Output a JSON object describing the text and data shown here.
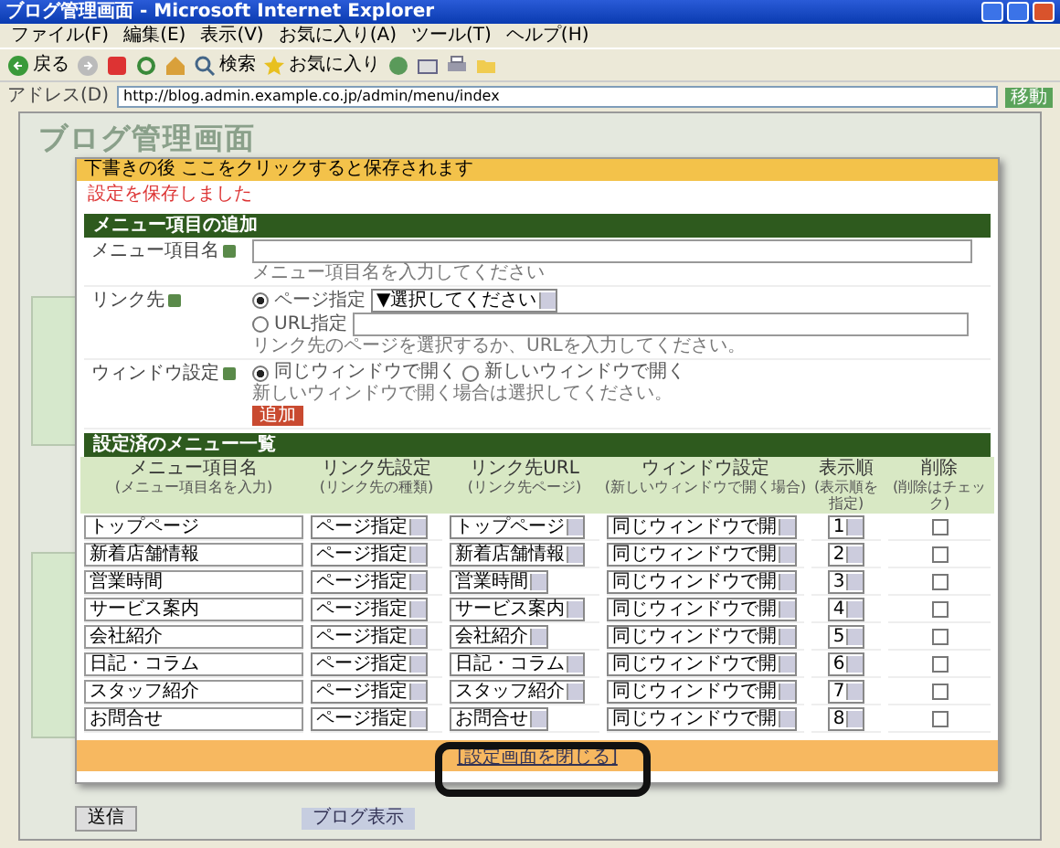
{
  "window": {
    "title": "ブログ管理画面 - Microsoft Internet Explorer"
  },
  "menu_bar": [
    "ファイル(F)",
    "編集(E)",
    "表示(V)",
    "お気に入り(A)",
    "ツール(T)",
    "ヘルプ(H)"
  ],
  "toolbar": {
    "back": "戻る",
    "search": "検索",
    "favorites": "お気に入り"
  },
  "address_bar": {
    "label": "アドレス(D)",
    "value": "http://blog.admin.example.co.jp/admin/menu/index",
    "go": "移動"
  },
  "page": {
    "heading": "ブログ管理画面",
    "send_button": "送信",
    "blog_link": "ブログ表示"
  },
  "dialog": {
    "notice": "下書きの後 ここをクリックすると保存されます",
    "message": "設定を保存しました",
    "add_section": {
      "title": "メニュー項目の追加",
      "name_field": {
        "label": "メニュー項目名",
        "hint": "メニュー項目名を入力してください"
      },
      "link_field": {
        "label": "リンク先",
        "options": [
          {
            "label": "ページ指定",
            "selected": true,
            "kind": "select",
            "value": "▼選択してください"
          },
          {
            "label": "URL指定",
            "selected": false,
            "kind": "input"
          }
        ],
        "hint": "リンク先のページを選択するか、URLを入力してください。"
      },
      "window_field": {
        "label": "ウィンドウ設定",
        "options": [
          {
            "label": "同じウィンドウで開く",
            "selected": true
          },
          {
            "label": "新しいウィンドウで開く",
            "selected": false
          }
        ],
        "hint": "新しいウィンドウで開く場合は選択してください。"
      },
      "submit": "追加"
    },
    "list_section": {
      "title": "設定済のメニュー一覧",
      "columns": [
        {
          "title": "メニュー項目名",
          "subtitle": "(メニュー項目名を入力)"
        },
        {
          "title": "リンク先設定",
          "subtitle": "(リンク先の種類)"
        },
        {
          "title": "リンク先URL",
          "subtitle": "(リンク先ページ)"
        },
        {
          "title": "ウィンドウ設定",
          "subtitle": "(新しいウィンドウで開く場合)"
        },
        {
          "title": "表示順",
          "subtitle": "(表示順を指定)"
        },
        {
          "title": "削除",
          "subtitle": "(削除はチェック)"
        }
      ],
      "rows": [
        {
          "name": "トップページ",
          "link_type": "ページ指定",
          "target": "トップページ",
          "window": "同じウィンドウで開",
          "order": "1",
          "delete": false
        },
        {
          "name": "新着店舗情報",
          "link_type": "ページ指定",
          "target": "新着店舗情報",
          "window": "同じウィンドウで開",
          "order": "2",
          "delete": false
        },
        {
          "name": "営業時間",
          "link_type": "ページ指定",
          "target": "営業時間",
          "window": "同じウィンドウで開",
          "order": "3",
          "delete": false
        },
        {
          "name": "サービス案内",
          "link_type": "ページ指定",
          "target": "サービス案内",
          "window": "同じウィンドウで開",
          "order": "4",
          "delete": false
        },
        {
          "name": "会社紹介",
          "link_type": "ページ指定",
          "target": "会社紹介",
          "window": "同じウィンドウで開",
          "order": "5",
          "delete": false
        },
        {
          "name": "日記・コラム",
          "link_type": "ページ指定",
          "target": "日記・コラム",
          "window": "同じウィンドウで開",
          "order": "6",
          "delete": false
        },
        {
          "name": "スタッフ紹介",
          "link_type": "ページ指定",
          "target": "スタッフ紹介",
          "window": "同じウィンドウで開",
          "order": "7",
          "delete": false
        },
        {
          "name": "お問合せ",
          "link_type": "ページ指定",
          "target": "お問合せ",
          "window": "同じウィンドウで開",
          "order": "8",
          "delete": false
        }
      ]
    },
    "close_link": "[設定画面を閉じる]"
  }
}
